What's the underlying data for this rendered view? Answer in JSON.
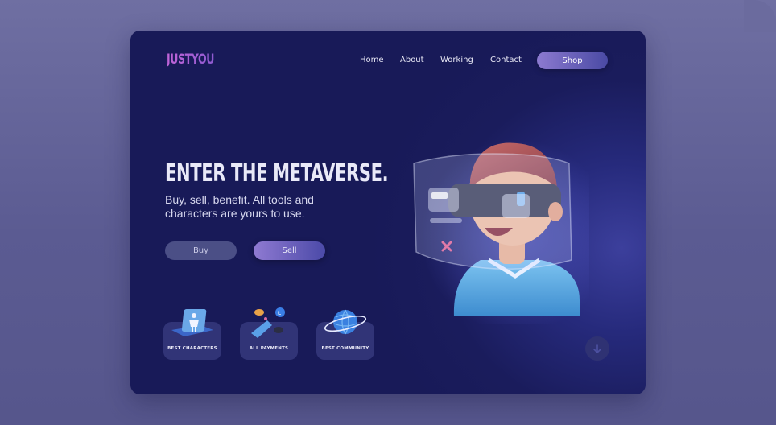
{
  "brand": {
    "logo": "JUSTYOU"
  },
  "nav": {
    "items": [
      "Home",
      "About",
      "Working",
      "Contact"
    ],
    "shop_label": "Shop"
  },
  "hero": {
    "title": "ENTER THE METAVERSE.",
    "subtitle": "Buy, sell, benefit. All tools and characters are yours to use.",
    "buy_label": "Buy",
    "sell_label": "Sell"
  },
  "features": [
    {
      "label": "BEST CHARACTERS",
      "icon": "character-icon"
    },
    {
      "label": "ALL PAYMENTS",
      "icon": "payment-icon"
    },
    {
      "label": "BEST COMMUNITY",
      "icon": "globe-icon"
    }
  ],
  "scroll": {
    "icon": "arrow-down-icon"
  },
  "colors": {
    "card_bg": "#1a1c5c",
    "accent": "#8c7ad0",
    "logo": "#c064d8"
  }
}
